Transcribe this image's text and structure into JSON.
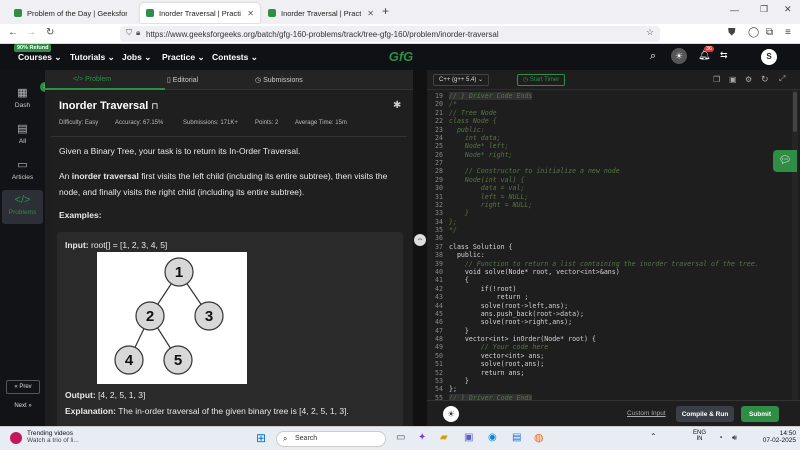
{
  "browser": {
    "tabs": [
      {
        "title": "Problem of the Day | GeeksforG"
      },
      {
        "title": "Inorder Traversal | Practice | Ge"
      },
      {
        "title": "Inorder Traversal | Practice | Ge"
      }
    ],
    "url": "https://www.geeksforgeeks.org/batch/gfg-160-problems/track/tree-gfg-160/problem/inorder-traversal"
  },
  "header": {
    "refund_badge": "90% Refund",
    "menu": [
      "Courses",
      "Tutorials",
      "Jobs",
      "Practice",
      "Contests"
    ],
    "logo": "GfG",
    "notification_count": "36",
    "avatar_letter": "S"
  },
  "leftnav": {
    "items": [
      {
        "label": "Dash"
      },
      {
        "label": "All"
      },
      {
        "label": "Articles"
      },
      {
        "label": "Problems"
      }
    ],
    "prev": "« Prev",
    "next": "Next »"
  },
  "problem": {
    "tabs": [
      "</> Problem",
      "Editorial",
      "Submissions"
    ],
    "title": "Inorder Traversal",
    "difficulty": "Difficulty: Easy",
    "accuracy": "Accuracy: 67.15%",
    "submissions": "Submissions: 171K+",
    "points": "Points: 2",
    "avg_time": "Average Time: 15m",
    "statement": "Given a Binary Tree, your task is to return its In-Order Traversal.",
    "desc_prefix": "An ",
    "desc_bold": "inorder traversal",
    "desc_rest": " first visits the left child (including its entire subtree), then visits the node, and finally visits the right child (including its entire subtree).",
    "examples_heading": "Examples:",
    "input_label": "Input:",
    "input_value": "root[] = [1, 2, 3, 4, 5]",
    "tree_nodes": [
      "1",
      "2",
      "3",
      "4",
      "5"
    ],
    "output_label": "Output:",
    "output_value": "[4, 2, 5, 1, 3]",
    "explanation_label": "Explanation:",
    "explanation_value": "The in-order traversal of the given binary tree is [4, 2, 5, 1, 3]."
  },
  "editor": {
    "language": "C++ (g++ 5.4)",
    "timer": "Start Timer",
    "lines": [
      {
        "n": "19",
        "t": "// } Driver Code Ends"
      },
      {
        "n": "20",
        "t": "/*"
      },
      {
        "n": "21",
        "t": "// Tree Node"
      },
      {
        "n": "22",
        "t": "class Node {"
      },
      {
        "n": "23",
        "t": "  public:"
      },
      {
        "n": "24",
        "t": "    int data;"
      },
      {
        "n": "25",
        "t": "    Node* left;"
      },
      {
        "n": "26",
        "t": "    Node* right;"
      },
      {
        "n": "27",
        "t": ""
      },
      {
        "n": "28",
        "t": "    // Constructor to initialize a new node"
      },
      {
        "n": "29",
        "t": "    Node(int val) {"
      },
      {
        "n": "30",
        "t": "        data = val;"
      },
      {
        "n": "31",
        "t": "        left = NULL;"
      },
      {
        "n": "32",
        "t": "        right = NULL;"
      },
      {
        "n": "33",
        "t": "    }"
      },
      {
        "n": "34",
        "t": "};"
      },
      {
        "n": "35",
        "t": "*/"
      },
      {
        "n": "36",
        "t": ""
      },
      {
        "n": "37",
        "t": "class Solution {"
      },
      {
        "n": "38",
        "t": "  public:"
      },
      {
        "n": "39",
        "t": "    // Function to return a list containing the inorder traversal of the tree."
      },
      {
        "n": "40",
        "t": "    void solve(Node* root, vector<int>&ans)"
      },
      {
        "n": "41",
        "t": "    {"
      },
      {
        "n": "42",
        "t": "        if(!root)"
      },
      {
        "n": "43",
        "t": "            return ;"
      },
      {
        "n": "44",
        "t": "        solve(root->left,ans);"
      },
      {
        "n": "45",
        "t": "        ans.push_back(root->data);"
      },
      {
        "n": "46",
        "t": "        solve(root->right,ans);"
      },
      {
        "n": "47",
        "t": "    }"
      },
      {
        "n": "48",
        "t": "    vector<int> inOrder(Node* root) {"
      },
      {
        "n": "49",
        "t": "        // Your code here"
      },
      {
        "n": "50",
        "t": "        vector<int> ans;"
      },
      {
        "n": "51",
        "t": "        solve(root,ans);"
      },
      {
        "n": "52",
        "t": "        return ans;"
      },
      {
        "n": "53",
        "t": "    }"
      },
      {
        "n": "54",
        "t": "};"
      },
      {
        "n": "55",
        "t": "// } Driver Code Ends"
      }
    ],
    "custom_input": "Custom Input",
    "compile_run": "Compile & Run",
    "submit": "Submit"
  },
  "taskbar": {
    "news_title": "Trending videos",
    "news_sub": "Watch a trio of li...",
    "search": "Search",
    "lang": "ENG",
    "lang2": "IN",
    "time": "14:50",
    "date": "07-02-2025"
  },
  "colors": {
    "accent_green": "#2f8d46",
    "panel_bg": "#1e1e1e",
    "submit_green": "#2f8d46"
  }
}
